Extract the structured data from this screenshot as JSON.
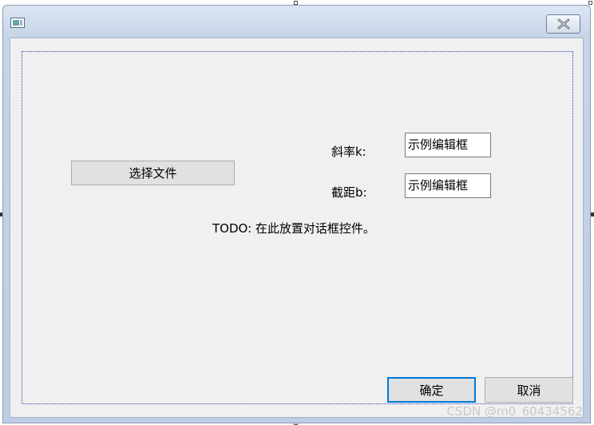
{
  "window": {
    "title": "",
    "close_glyph": "✕"
  },
  "dialog": {
    "choose_file_button": "选择文件",
    "slope_label": "斜率k:",
    "slope_value": "示例编辑框",
    "intercept_label": "截距b:",
    "intercept_value": "示例编辑框",
    "todo_text": "TODO: 在此放置对话框控件。",
    "ok_button": "确定",
    "cancel_button": "取消"
  },
  "watermark": "CSDN @m0_60434562",
  "colors": {
    "client_bg": "#f0f0f0",
    "titlebar": "#c6d4e8",
    "default_button_border": "#0078d7",
    "guide_border": "#2a3fbf"
  }
}
